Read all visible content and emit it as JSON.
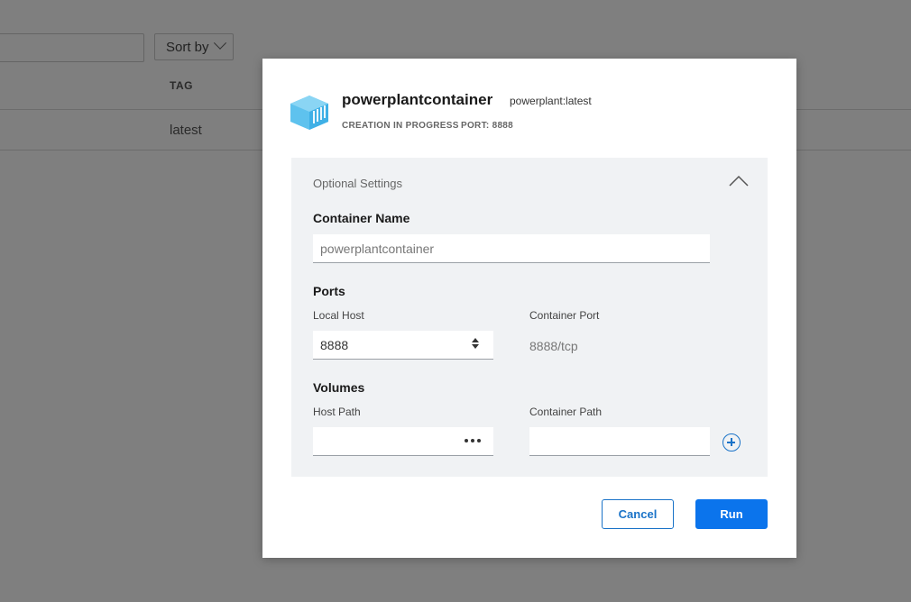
{
  "background": {
    "sort_label": "Sort by",
    "table": {
      "header_tag": "TAG",
      "rows": [
        {
          "tag": "latest"
        }
      ]
    }
  },
  "dialog": {
    "title": "powerplantcontainer",
    "image_tag": "powerplant:latest",
    "status": "CREATION IN PROGRESS",
    "port": "PORT: 8888",
    "icon": "container-cube-icon",
    "optional_settings": {
      "title": "Optional Settings",
      "container_name": {
        "label": "Container Name",
        "placeholder": "powerplantcontainer",
        "value": ""
      },
      "ports": {
        "label": "Ports",
        "local_host_label": "Local Host",
        "local_host_value": "8888",
        "container_port_label": "Container Port",
        "container_port_value": "8888/tcp"
      },
      "volumes": {
        "label": "Volumes",
        "host_path_label": "Host Path",
        "host_path_value": "",
        "container_path_label": "Container Path",
        "container_path_value": ""
      }
    },
    "buttons": {
      "cancel": "Cancel",
      "run": "Run"
    }
  },
  "colors": {
    "accent": "#0b74ec",
    "overlay": "rgba(0,0,0,0.5)",
    "panel": "#f0f2f4",
    "cube": "#5ec2ee"
  }
}
